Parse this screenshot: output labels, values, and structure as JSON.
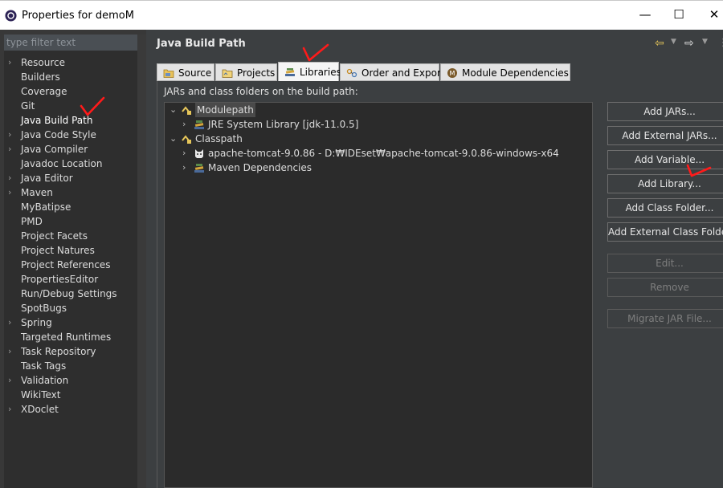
{
  "window": {
    "title": "Properties for demoM",
    "minimize": "—",
    "maximize": "☐",
    "close": "✕"
  },
  "sidebar": {
    "filter_placeholder": "type filter text",
    "items": [
      {
        "label": "Resource",
        "expandable": true
      },
      {
        "label": "Builders",
        "expandable": false
      },
      {
        "label": "Coverage",
        "expandable": false
      },
      {
        "label": "Git",
        "expandable": false
      },
      {
        "label": "Java Build Path",
        "expandable": false,
        "selected": true
      },
      {
        "label": "Java Code Style",
        "expandable": true
      },
      {
        "label": "Java Compiler",
        "expandable": true
      },
      {
        "label": "Javadoc Location",
        "expandable": false
      },
      {
        "label": "Java Editor",
        "expandable": true
      },
      {
        "label": "Maven",
        "expandable": true
      },
      {
        "label": "MyBatipse",
        "expandable": false
      },
      {
        "label": "PMD",
        "expandable": false
      },
      {
        "label": "Project Facets",
        "expandable": false
      },
      {
        "label": "Project Natures",
        "expandable": false
      },
      {
        "label": "Project References",
        "expandable": false
      },
      {
        "label": "PropertiesEditor",
        "expandable": false
      },
      {
        "label": "Run/Debug Settings",
        "expandable": false
      },
      {
        "label": "SpotBugs",
        "expandable": false
      },
      {
        "label": "Spring",
        "expandable": true
      },
      {
        "label": "Targeted Runtimes",
        "expandable": false
      },
      {
        "label": "Task Repository",
        "expandable": true
      },
      {
        "label": "Task Tags",
        "expandable": false
      },
      {
        "label": "Validation",
        "expandable": true
      },
      {
        "label": "WikiText",
        "expandable": false
      },
      {
        "label": "XDoclet",
        "expandable": true
      }
    ]
  },
  "main": {
    "title": "Java Build Path",
    "tabs": [
      {
        "label": "Source",
        "icon": "source-folder-icon"
      },
      {
        "label": "Projects",
        "icon": "projects-icon"
      },
      {
        "label": "Libraries",
        "icon": "libraries-icon",
        "active": true
      },
      {
        "label": "Order and Export",
        "icon": "order-export-icon"
      },
      {
        "label": "Module Dependencies",
        "icon": "module-icon"
      }
    ],
    "jar_label": "JARs and class folders on the build path:",
    "tree": [
      {
        "label": "Modulepath",
        "level": 0,
        "expanded": true,
        "icon": "modulepath-icon",
        "selected": true
      },
      {
        "label": "JRE System Library [jdk-11.0.5]",
        "level": 1,
        "expanded": false,
        "icon": "library-icon"
      },
      {
        "label": "Classpath",
        "level": 0,
        "expanded": true,
        "icon": "classpath-icon"
      },
      {
        "label": "apache-tomcat-9.0.86 - D:₩IDEset₩apache-tomcat-9.0.86-windows-x64",
        "level": 1,
        "expanded": false,
        "icon": "tomcat-icon"
      },
      {
        "label": "Maven Dependencies",
        "level": 1,
        "expanded": false,
        "icon": "library-icon"
      }
    ],
    "buttons": [
      {
        "label": "Add JARs...",
        "enabled": true
      },
      {
        "label": "Add External JARs...",
        "enabled": true
      },
      {
        "label": "Add Variable...",
        "enabled": true
      },
      {
        "label": "Add Library...",
        "enabled": true
      },
      {
        "label": "Add Class Folder...",
        "enabled": true
      },
      {
        "label": "Add External Class Folder...",
        "enabled": true
      },
      {
        "label": "Edit...",
        "enabled": false
      },
      {
        "label": "Remove",
        "enabled": false
      },
      {
        "label": "Migrate JAR File...",
        "enabled": false
      }
    ]
  },
  "colors": {
    "annotation": "#ff1a1a",
    "history_back": "#e6c65a"
  }
}
